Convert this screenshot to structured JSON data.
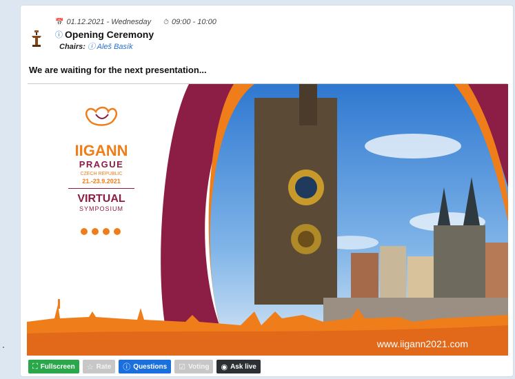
{
  "session": {
    "date": "01.12.2021 - Wednesday",
    "time": "09:00 - 10:00",
    "title": "Opening Ceremony",
    "chairs_label": "Chairs:",
    "chair_name": "Aleš Basík"
  },
  "status_text": "We are waiting for the next presentation...",
  "banner": {
    "logo_line1": "IIGANN",
    "logo_line2": "PRAGUE",
    "logo_line3": "CZECH REPUBLIC",
    "logo_dates": "21.-23.9.2021",
    "logo_virtual": "VIRTUAL",
    "logo_symposium": "SYMPOSIUM",
    "url": "www.iigann2021.com",
    "colors": {
      "orange": "#ef7d1a",
      "maroon": "#8c1d45",
      "sky": "#4a8fd8"
    }
  },
  "toolbar": {
    "fullscreen": "Fullscreen",
    "rate": "Rate",
    "questions": "Questions",
    "voting": "Voting",
    "ask_live": "Ask live"
  },
  "icons": {
    "podium": "podium-icon",
    "calendar": "calendar-icon",
    "clock": "clock-icon",
    "info": "info-icon"
  }
}
